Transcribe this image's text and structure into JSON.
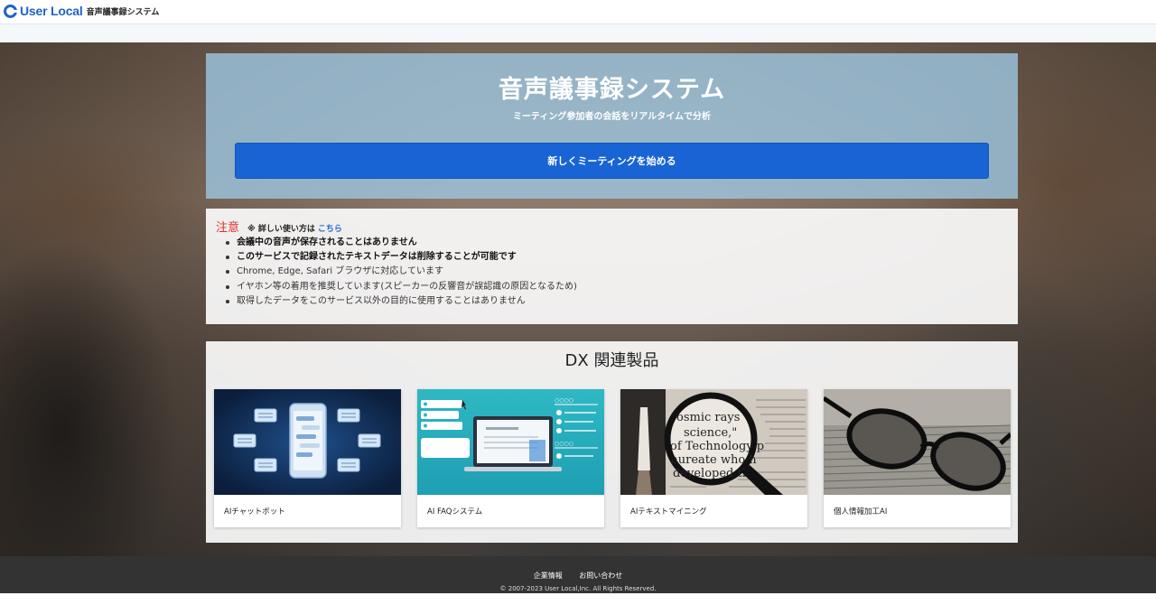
{
  "header": {
    "logo_text": "User Local",
    "logo_sub": "音声議事録システム"
  },
  "hero": {
    "title": "音声議事録システム",
    "subtitle": "ミーティング参加者の会話をリアルタイムで分析",
    "start_button": "新しくミーティングを始める"
  },
  "notice": {
    "label": "注意",
    "help_text": "※ 詳しい使い方は",
    "help_link": "こちら",
    "items": [
      "会議中の音声が保存されることはありません",
      "このサービスで記録されたテキストデータは削除することが可能です",
      "Chrome, Edge, Safari ブラウザに対応しています",
      "イヤホン等の着用を推奨しています(スピーカーの反響音が誤認識の原因となるため)",
      "取得したデータをこのサービス以外の目的に使用することはありません"
    ]
  },
  "dx": {
    "title": "DX 関連製品",
    "products": [
      {
        "name": "AIチャットボット",
        "icon": "chatbot-thumbnail"
      },
      {
        "name": "AI FAQシステム",
        "icon": "faq-thumbnail"
      },
      {
        "name": "AIテキストマイニング",
        "icon": "magnifier-thumbnail"
      },
      {
        "name": "個人情報加工AI",
        "icon": "glasses-thumbnail"
      }
    ],
    "magnifier_text": [
      "osmic rays",
      "science,\"",
      "of Technology p",
      "aureate who h",
      "developed the"
    ]
  },
  "footer": {
    "links": [
      "企業情報",
      "お問い合わせ"
    ],
    "copyright": "© 2007-2023 User Local,Inc. All Rights Reserved."
  },
  "colors": {
    "brand": "#1e63c8",
    "start_button": "#1964d4",
    "notice_label": "#e0312a",
    "footer": "#333333"
  }
}
